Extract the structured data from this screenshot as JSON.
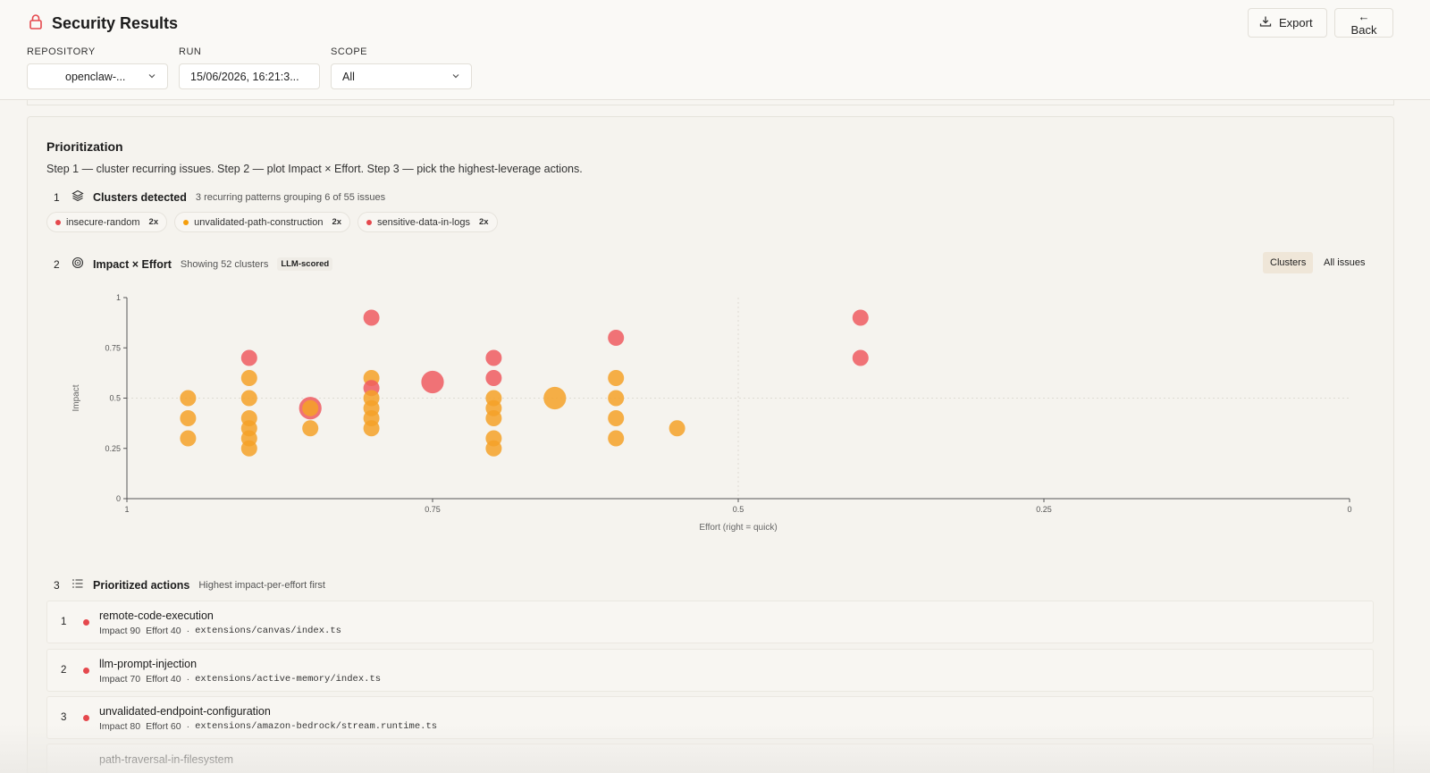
{
  "header": {
    "title": "Security Results",
    "lock_icon": "lock-icon",
    "export_label": "Export",
    "back_label": "← Back"
  },
  "filters": {
    "repository": {
      "label": "REPOSITORY",
      "value": "openclaw-..."
    },
    "run": {
      "label": "RUN",
      "value": "15/06/2026, 16:21:3..."
    },
    "scope": {
      "label": "SCOPE",
      "value": "All"
    }
  },
  "prioritization": {
    "title": "Prioritization",
    "description": "Step 1 — cluster recurring issues. Step 2 — plot Impact × Effort. Step 3 — pick the highest-leverage actions.",
    "step1": {
      "num": "1",
      "title": "Clusters detected",
      "subtitle": "3 recurring patterns grouping 6 of 55 issues",
      "chips": [
        {
          "label": "insecure-random",
          "count": "2x",
          "color": "#e5484d"
        },
        {
          "label": "unvalidated-path-construction",
          "count": "2x",
          "color": "#f59e0b"
        },
        {
          "label": "sensitive-data-in-logs",
          "count": "2x",
          "color": "#e5484d"
        }
      ]
    },
    "step2": {
      "num": "2",
      "title": "Impact × Effort",
      "subtitle": "Showing 52 clusters",
      "badge": "LLM-scored",
      "toggle_clusters": "Clusters",
      "toggle_all": "All issues"
    },
    "step3": {
      "num": "3",
      "title": "Prioritized actions",
      "subtitle": "Highest impact-per-effort first",
      "actions": [
        {
          "num": "1",
          "name": "remote-code-execution",
          "impact": "Impact 90",
          "effort": "Effort 40",
          "sep": "·",
          "path": "extensions/canvas/index.ts",
          "color": "#e5484d"
        },
        {
          "num": "2",
          "name": "llm-prompt-injection",
          "impact": "Impact 70",
          "effort": "Effort 40",
          "sep": "·",
          "path": "extensions/active-memory/index.ts",
          "color": "#e5484d"
        },
        {
          "num": "3",
          "name": "unvalidated-endpoint-configuration",
          "impact": "Impact 80",
          "effort": "Effort 60",
          "sep": "·",
          "path": "extensions/amazon-bedrock/stream.runtime.ts",
          "color": "#e5484d"
        },
        {
          "num": "",
          "name": "path-traversal-in-filesystem",
          "impact": "",
          "effort": "",
          "sep": "",
          "path": "",
          "color": "#e5484d"
        }
      ]
    }
  },
  "chart_data": {
    "type": "scatter",
    "xlabel": "Effort (right = quick)",
    "ylabel": "Impact",
    "xlim": [
      1,
      0
    ],
    "ylim": [
      0,
      1
    ],
    "x_reversed": true,
    "xticks": [
      "1",
      "0.75",
      "0.5",
      "0.25",
      "0"
    ],
    "yticks": [
      "0",
      "0.25",
      "0.5",
      "0.75",
      "1"
    ],
    "colors": {
      "high": "#ef5a60",
      "medium": "#f5a128"
    },
    "points": [
      {
        "x": 0.95,
        "y": 0.5,
        "sev": "medium",
        "size": 1
      },
      {
        "x": 0.95,
        "y": 0.4,
        "sev": "medium",
        "size": 1
      },
      {
        "x": 0.95,
        "y": 0.3,
        "sev": "medium",
        "size": 1
      },
      {
        "x": 0.9,
        "y": 0.7,
        "sev": "high",
        "size": 1
      },
      {
        "x": 0.9,
        "y": 0.6,
        "sev": "medium",
        "size": 1
      },
      {
        "x": 0.9,
        "y": 0.5,
        "sev": "medium",
        "size": 1
      },
      {
        "x": 0.9,
        "y": 0.4,
        "sev": "medium",
        "size": 1
      },
      {
        "x": 0.9,
        "y": 0.35,
        "sev": "medium",
        "size": 1
      },
      {
        "x": 0.9,
        "y": 0.3,
        "sev": "medium",
        "size": 1
      },
      {
        "x": 0.9,
        "y": 0.25,
        "sev": "medium",
        "size": 1
      },
      {
        "x": 0.85,
        "y": 0.45,
        "sev": "high",
        "size": 1.4
      },
      {
        "x": 0.85,
        "y": 0.45,
        "sev": "medium",
        "size": 1
      },
      {
        "x": 0.85,
        "y": 0.35,
        "sev": "medium",
        "size": 1
      },
      {
        "x": 0.8,
        "y": 0.9,
        "sev": "high",
        "size": 1
      },
      {
        "x": 0.8,
        "y": 0.6,
        "sev": "medium",
        "size": 1
      },
      {
        "x": 0.8,
        "y": 0.55,
        "sev": "high",
        "size": 1
      },
      {
        "x": 0.8,
        "y": 0.5,
        "sev": "medium",
        "size": 1
      },
      {
        "x": 0.8,
        "y": 0.45,
        "sev": "medium",
        "size": 1
      },
      {
        "x": 0.8,
        "y": 0.4,
        "sev": "medium",
        "size": 1
      },
      {
        "x": 0.8,
        "y": 0.35,
        "sev": "medium",
        "size": 1
      },
      {
        "x": 0.75,
        "y": 0.58,
        "sev": "high",
        "size": 1.4
      },
      {
        "x": 0.7,
        "y": 0.7,
        "sev": "high",
        "size": 1
      },
      {
        "x": 0.7,
        "y": 0.6,
        "sev": "high",
        "size": 1
      },
      {
        "x": 0.7,
        "y": 0.5,
        "sev": "medium",
        "size": 1
      },
      {
        "x": 0.7,
        "y": 0.45,
        "sev": "medium",
        "size": 1
      },
      {
        "x": 0.7,
        "y": 0.4,
        "sev": "medium",
        "size": 1
      },
      {
        "x": 0.7,
        "y": 0.3,
        "sev": "medium",
        "size": 1
      },
      {
        "x": 0.7,
        "y": 0.25,
        "sev": "medium",
        "size": 1
      },
      {
        "x": 0.65,
        "y": 0.5,
        "sev": "medium",
        "size": 1.4
      },
      {
        "x": 0.6,
        "y": 0.8,
        "sev": "high",
        "size": 1
      },
      {
        "x": 0.6,
        "y": 0.6,
        "sev": "medium",
        "size": 1
      },
      {
        "x": 0.6,
        "y": 0.5,
        "sev": "medium",
        "size": 1
      },
      {
        "x": 0.6,
        "y": 0.4,
        "sev": "medium",
        "size": 1
      },
      {
        "x": 0.6,
        "y": 0.3,
        "sev": "medium",
        "size": 1
      },
      {
        "x": 0.55,
        "y": 0.35,
        "sev": "medium",
        "size": 1
      },
      {
        "x": 0.4,
        "y": 0.9,
        "sev": "high",
        "size": 1
      },
      {
        "x": 0.4,
        "y": 0.7,
        "sev": "high",
        "size": 1
      }
    ]
  }
}
